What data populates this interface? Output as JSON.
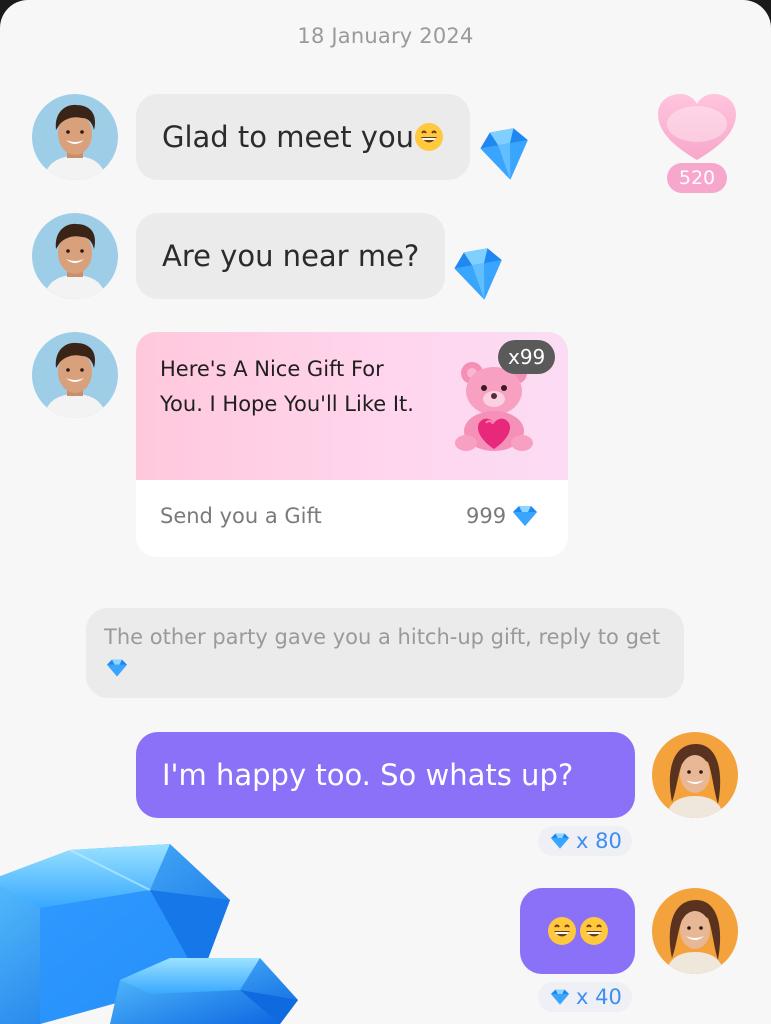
{
  "chat": {
    "date": "18 January 2024",
    "heart_badge": "520",
    "messages_in": [
      {
        "text": "Glad to meet you"
      },
      {
        "text": "Are you near me?"
      }
    ],
    "gift": {
      "text": "Here's A Nice Gift For You. I Hope You'll Like It.",
      "count": "x99",
      "label": "Send you a Gift",
      "value": "999"
    },
    "notice": "The other party gave you a hitch-up gift, reply to get",
    "messages_out": [
      {
        "text": "I'm happy too. So whats up?",
        "reward": "x 80"
      },
      {
        "text": "",
        "reward": "x 40"
      }
    ]
  },
  "icons": {
    "diamond": "blue-diamond-icon",
    "heart": "heart-icon",
    "bear": "teddy-bear-gift-icon",
    "emoji": "grinning-face-emoji"
  },
  "colors": {
    "outgoing_bubble": "#8b70f8",
    "incoming_bubble": "#ebebeb",
    "gift_gradient_start": "#ffc8dc",
    "reward_text": "#3d8ef0",
    "heart_badge": "#f8a7cc"
  }
}
